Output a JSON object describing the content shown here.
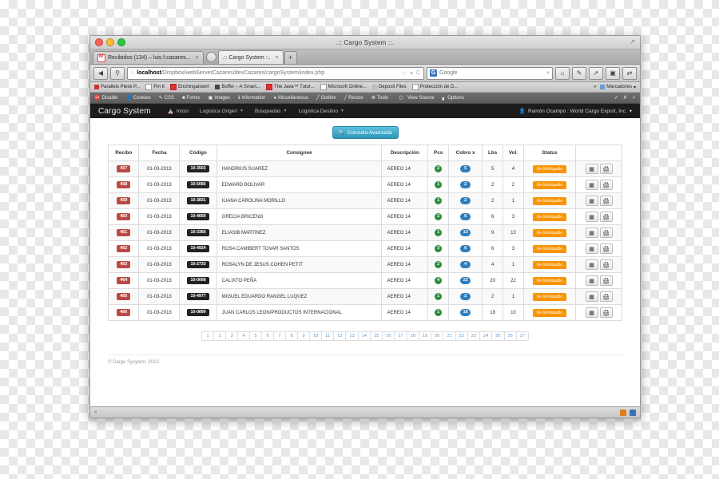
{
  "window": {
    "title": ".:: Cargo System ::.",
    "traffic_lights": [
      "close",
      "minimize",
      "zoom"
    ],
    "resize_icon": "resize-corner-icon"
  },
  "tabs": [
    {
      "label": "Recibidos (134) – luis.f.cazares...",
      "icon": "gmail-icon",
      "active": false,
      "close": "×"
    },
    {
      "label": ".:: Cargo System ::.",
      "icon": "page-icon",
      "active": true,
      "close": "×"
    }
  ],
  "new_tab_label": "+",
  "toolbar": {
    "back_icon": "◀",
    "forward_icon": "▶",
    "url_lock_icon": "○",
    "url_host": "localhost",
    "url_path": "/Dropbox/webServerCazares/devCazares/cargoSystem/index.php",
    "star_icon": "☆",
    "dropdown_icon": "▾",
    "reload_icon": "C",
    "search_engine": "Google",
    "search_placeholder": "Google",
    "search_icon": "⌕",
    "home_icon": "⌂",
    "extra_buttons": [
      "bookmarks-button",
      "downloads-button",
      "readerlist-button",
      "sync-button"
    ]
  },
  "bookmarks": [
    {
      "label": "Parallels Plesk P...",
      "icon": "parallels-icon"
    },
    {
      "label": "Pin It",
      "icon": "pinterest-icon"
    },
    {
      "label": "Enchingatown!",
      "icon": "enchingatown-icon"
    },
    {
      "label": "Buffer – A Smart...",
      "icon": "buffer-icon"
    },
    {
      "label": "The Java™ Tutor...",
      "icon": "java-icon"
    },
    {
      "label": "Microsoft Online...",
      "icon": "microsoft-icon"
    },
    {
      "label": "Deposit Files",
      "icon": "depositfiles-icon"
    },
    {
      "label": "Protección de D...",
      "icon": "proteccion-icon"
    }
  ],
  "bookmarks_overflow": "»",
  "bookmarks_menu": "Marcadores",
  "devtoolbar": {
    "items": [
      {
        "label": "Disable",
        "icon": "disable-icon"
      },
      {
        "label": "Cookies",
        "icon": "cookies-icon"
      },
      {
        "label": "CSS",
        "icon": "css-icon"
      },
      {
        "label": "Forms",
        "icon": "forms-icon"
      },
      {
        "label": "Images",
        "icon": "images-icon"
      },
      {
        "label": "Information",
        "icon": "information-icon"
      },
      {
        "label": "Miscellaneous",
        "icon": "miscellaneous-icon"
      },
      {
        "label": "Outline",
        "icon": "outline-icon"
      },
      {
        "label": "Resize",
        "icon": "resize-icon"
      },
      {
        "label": "Tools",
        "icon": "tools-icon"
      },
      {
        "label": "View Source",
        "icon": "view-source-icon"
      },
      {
        "label": "Options",
        "icon": "options-icon"
      }
    ],
    "right_icons": [
      "check-icon",
      "cross-icon",
      "check-icon"
    ]
  },
  "app": {
    "brand": "Cargo System",
    "nav": [
      {
        "label": "Inicio",
        "icon": "home-icon",
        "caret": false
      },
      {
        "label": "Logistica Origen",
        "icon": null,
        "caret": true
      },
      {
        "label": "Búsquedas",
        "icon": null,
        "caret": true
      },
      {
        "label": "Logistica Destino",
        "icon": null,
        "caret": true
      }
    ],
    "user": {
      "icon": "user-icon",
      "label": "Ramón Ocampo : World Cargo Export, Inc.",
      "caret": "▾"
    },
    "advanced_search_button": {
      "label": "Consulta Avanzada",
      "icon": "search-icon",
      "color": "#5bc0de"
    },
    "table": {
      "columns": [
        "Recibo",
        "Fecha",
        "Código",
        "Consignee",
        "Descripción",
        "Pcs",
        "Cobro x",
        "Lbs",
        "Vol.",
        "Status",
        ""
      ],
      "rows": [
        {
          "recibo": "457",
          "fecha": "01-03-2013",
          "codigo": "10-3503",
          "consignee": "HANDRIUS SUAREZ",
          "descripcion": "AEREO 14",
          "pcs": "2",
          "cobro": "5",
          "lbs": "5",
          "vol": "4",
          "status": "No Entregado"
        },
        {
          "recibo": "458",
          "fecha": "01-03-2013",
          "codigo": "10-5066",
          "consignee": "EDWARD BOLIVAR",
          "descripcion": "AEREO 14",
          "pcs": "1",
          "cobro": "2",
          "lbs": "2",
          "vol": "2",
          "status": "No Entregado"
        },
        {
          "recibo": "459",
          "fecha": "01-03-2013",
          "codigo": "10-3831",
          "consignee": "ILIANA CAROLINA MORILLO",
          "descripcion": "AEREO 14",
          "pcs": "1",
          "cobro": "2",
          "lbs": "2",
          "vol": "1",
          "status": "No Entregado"
        },
        {
          "recibo": "460",
          "fecha": "01-03-2013",
          "codigo": "10-4669",
          "consignee": "GRECIA BRICENO",
          "descripcion": "AEREO 14",
          "pcs": "2",
          "cobro": "6",
          "lbs": "6",
          "vol": "3",
          "status": "No Entregado"
        },
        {
          "recibo": "461",
          "fecha": "01-03-2013",
          "codigo": "10-3366",
          "consignee": "ELIASIB MARTINEZ",
          "descripcion": "AEREO 14",
          "pcs": "1",
          "cobro": "13",
          "lbs": "9",
          "vol": "13",
          "status": "No Entregado"
        },
        {
          "recibo": "462",
          "fecha": "01-03-2013",
          "codigo": "10-4924",
          "consignee": "ROSA CAMIBERT TOVAR SANTOS",
          "descripcion": "AEREO 14",
          "pcs": "3",
          "cobro": "6",
          "lbs": "6",
          "vol": "3",
          "status": "No Entregado"
        },
        {
          "recibo": "463",
          "fecha": "01-03-2013",
          "codigo": "10-2733",
          "consignee": "ROSALYN DE JESUS COHEN PETIT",
          "descripcion": "AEREO 14",
          "pcs": "2",
          "cobro": "4",
          "lbs": "4",
          "vol": "1",
          "status": "No Entregado"
        },
        {
          "recibo": "464",
          "fecha": "01-03-2013",
          "codigo": "10-0008",
          "consignee": "CALIXTO PEÑA",
          "descripcion": "AEREO 14",
          "pcs": "4",
          "cobro": "22",
          "lbs": "20",
          "vol": "22",
          "status": "No Entregado"
        },
        {
          "recibo": "465",
          "fecha": "01-03-2013",
          "codigo": "10-4977",
          "consignee": "MIGUEL EDUARDO RANGEL LUQUEZ",
          "descripcion": "AEREO 14",
          "pcs": "1",
          "cobro": "2",
          "lbs": "2",
          "vol": "1",
          "status": "No Entregado"
        },
        {
          "recibo": "466",
          "fecha": "01-03-2013",
          "codigo": "10-0899",
          "consignee": "JUAN CARLOS LEON/PRODUCTOS INTERNACIONAL",
          "descripcion": "AEREO 14",
          "pcs": "1",
          "cobro": "18",
          "lbs": "18",
          "vol": "10",
          "status": "No Entregado"
        }
      ],
      "row_actions": [
        {
          "icon": "barcode-icon"
        },
        {
          "icon": "printer-icon"
        }
      ]
    },
    "pagination": [
      "1",
      "2",
      "3",
      "4",
      "5",
      "6",
      "7",
      "8",
      "9",
      "10",
      "11",
      "12",
      "13",
      "14",
      "15",
      "16",
      "17",
      "18",
      "19",
      "20",
      "21",
      "22",
      "23",
      "24",
      "25",
      "26",
      "27"
    ],
    "footer": "© Cargo Sysytem, 2013"
  },
  "statusbar": {
    "left_icon": "×",
    "right_icons": [
      "firebug-icon",
      "save-icon"
    ]
  },
  "colors": {
    "accent_info": "#5bc0de",
    "badge_red": "#b94a48",
    "badge_dark": "#222222",
    "badge_green": "#2e8b3c",
    "badge_blue": "#2d7fc1",
    "status_orange": "#f89406",
    "navbar_dark": "#1c1c1c",
    "pager_link": "#5a9bd5"
  }
}
